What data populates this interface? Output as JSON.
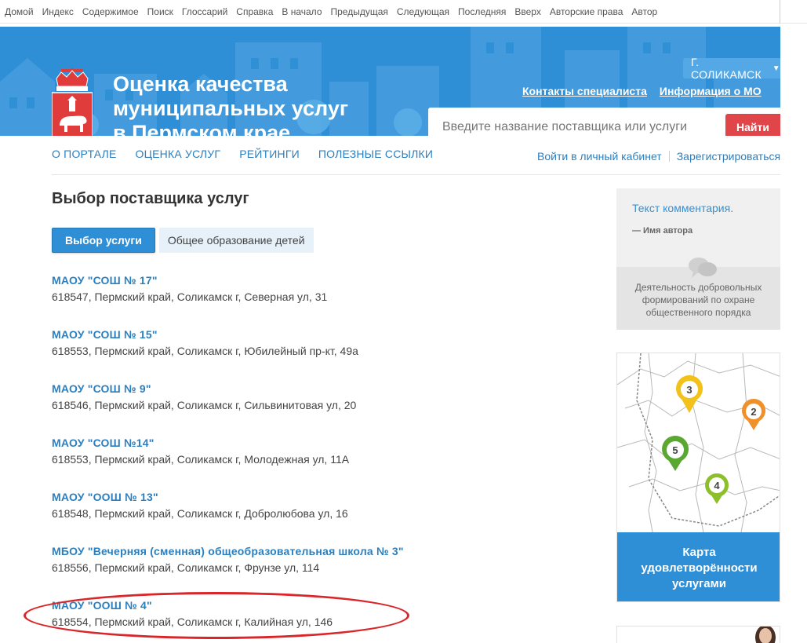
{
  "topnav": [
    "Домой",
    "Индекс",
    "Содержимое",
    "Поиск",
    "Глоссарий",
    "Справка",
    "В начало",
    "Предыдущая",
    "Следующая",
    "Последняя",
    "Вверх",
    "Авторские права",
    "Автор"
  ],
  "header": {
    "title_lines": [
      "Оценка качества",
      "муниципальных услуг",
      "в Пермском крае"
    ],
    "city": "Г. СОЛИКАМСК",
    "links": {
      "contacts": "Контакты специалиста",
      "mo_info": "Информация о МО"
    },
    "search": {
      "placeholder": "Введите название поставщика или услуги",
      "button": "Найти"
    }
  },
  "mainnav": {
    "about": "О ПОРТАЛЕ",
    "services": "ОЦЕНКА УСЛУГ",
    "ratings": "РЕЙТИНГИ",
    "links": "ПОЛЕЗНЫЕ ССЫЛКИ"
  },
  "auth": {
    "login": "Войти в личный кабинет",
    "register": "Зарегистрироваться"
  },
  "page": {
    "title": "Выбор поставщика услуг",
    "tab_active": "Выбор услуги",
    "tab_crumb": "Общее образование детей"
  },
  "providers": [
    {
      "name": "МАОУ \"СОШ № 17\"",
      "address": "618547, Пермский край, Соликамск г, Северная ул, 31"
    },
    {
      "name": "МАОУ \"СОШ № 15\"",
      "address": "618553, Пермский край, Соликамск г, Юбилейный пр-кт, 49а"
    },
    {
      "name": "МАОУ \"СОШ № 9\"",
      "address": "618546, Пермский край, Соликамск г, Сильвинитовая ул, 20"
    },
    {
      "name": "МАОУ \"СОШ №14\"",
      "address": "618553, Пермский край, Соликамск г, Молодежная ул, 11А"
    },
    {
      "name": "МАОУ \"ООШ № 13\"",
      "address": "618548, Пермский край, Соликамск г, Добролюбова ул, 16"
    },
    {
      "name": "МБОУ \"Вечерняя (сменная) общеобразовательная школа № 3\"",
      "address": "618556, Пермский край, Соликамск г, Фрунзе ул, 114"
    },
    {
      "name": "МАОУ \"ООШ № 4\"",
      "address": "618554, Пермский край, Соликамск г, Калийная ул, 146"
    }
  ],
  "sidebar": {
    "comment": {
      "text": "Текст комментария.",
      "author": "— Имя автора",
      "caption": "Деятельность добровольных формирований по охране общественного порядка"
    },
    "map": {
      "pins": [
        {
          "label": "3",
          "color": "#f2c21b"
        },
        {
          "label": "2",
          "color": "#f0902a"
        },
        {
          "label": "5",
          "color": "#5aa832"
        },
        {
          "label": "4",
          "color": "#8cbf2a"
        }
      ],
      "caption_lines": [
        "Карта",
        "удовлетворённости",
        "услугами"
      ]
    }
  },
  "colors": {
    "brand_blue": "#2f8fd6",
    "link_blue": "#2b7fbf",
    "search_red": "#e0454a",
    "highlight_red": "#d9262a"
  }
}
